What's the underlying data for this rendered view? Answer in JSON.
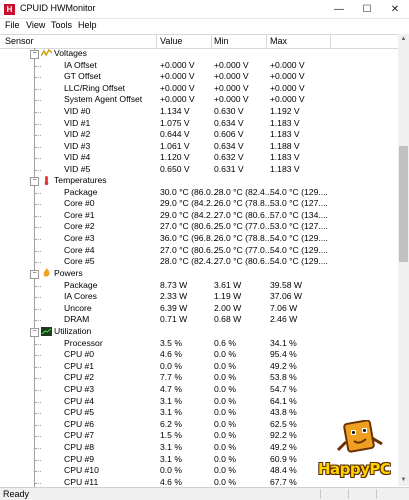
{
  "window": {
    "title": "CPUID HWMonitor",
    "app_icon": "H",
    "status": "Ready",
    "minimize_glyph": "—",
    "maximize_glyph": "☐",
    "close_glyph": "✕"
  },
  "menu": [
    "File",
    "View",
    "Tools",
    "Help"
  ],
  "columns": {
    "sensor": "Sensor",
    "value": "Value",
    "min": "Min",
    "max": "Max"
  },
  "categories": {
    "voltages": "Voltages",
    "temperatures": "Temperatures",
    "powers": "Powers",
    "utilization": "Utilization"
  },
  "rows": [
    {
      "name": "IA Offset",
      "value": "+0.000 V",
      "min": "+0.000 V",
      "max": "+0.000 V"
    },
    {
      "name": "GT Offset",
      "value": "+0.000 V",
      "min": "+0.000 V",
      "max": "+0.000 V"
    },
    {
      "name": "LLC/Ring Offset",
      "value": "+0.000 V",
      "min": "+0.000 V",
      "max": "+0.000 V"
    },
    {
      "name": "System Agent Offset",
      "value": "+0.000 V",
      "min": "+0.000 V",
      "max": "+0.000 V"
    },
    {
      "name": "VID #0",
      "value": "1.134 V",
      "min": "0.630 V",
      "max": "1.192 V"
    },
    {
      "name": "VID #1",
      "value": "1.075 V",
      "min": "0.634 V",
      "max": "1.183 V"
    },
    {
      "name": "VID #2",
      "value": "0.644 V",
      "min": "0.606 V",
      "max": "1.183 V"
    },
    {
      "name": "VID #3",
      "value": "1.061 V",
      "min": "0.634 V",
      "max": "1.188 V"
    },
    {
      "name": "VID #4",
      "value": "1.120 V",
      "min": "0.632 V",
      "max": "1.183 V"
    },
    {
      "name": "VID #5",
      "value": "0.650 V",
      "min": "0.631 V",
      "max": "1.183 V"
    },
    {
      "name": "Package",
      "value": "30.0 °C (86.0...",
      "min": "28.0 °C (82.4...",
      "max": "54.0 °C (129...."
    },
    {
      "name": "Core #0",
      "value": "29.0 °C (84.2...",
      "min": "26.0 °C (78.8...",
      "max": "53.0 °C (127...."
    },
    {
      "name": "Core #1",
      "value": "29.0 °C (84.2...",
      "min": "27.0 °C (80.6...",
      "max": "57.0 °C (134...."
    },
    {
      "name": "Core #2",
      "value": "27.0 °C (80.6...",
      "min": "25.0 °C (77.0...",
      "max": "53.0 °C (127...."
    },
    {
      "name": "Core #3",
      "value": "36.0 °C (96.8...",
      "min": "26.0 °C (78.8...",
      "max": "54.0 °C (129...."
    },
    {
      "name": "Core #4",
      "value": "27.0 °C (80.6...",
      "min": "25.0 °C (77.0...",
      "max": "54.0 °C (129...."
    },
    {
      "name": "Core #5",
      "value": "28.0 °C (82.4...",
      "min": "27.0 °C (80.6...",
      "max": "54.0 °C (129...."
    },
    {
      "name": "Package",
      "value": "8.73 W",
      "min": "3.61 W",
      "max": "39.58 W"
    },
    {
      "name": "IA Cores",
      "value": "2.33 W",
      "min": "1.19 W",
      "max": "37.06 W"
    },
    {
      "name": "Uncore",
      "value": "6.39 W",
      "min": "2.00 W",
      "max": "7.06 W"
    },
    {
      "name": "DRAM",
      "value": "0.71 W",
      "min": "0.68 W",
      "max": "2.46 W"
    },
    {
      "name": "Processor",
      "value": "3.5 %",
      "min": "0.6 %",
      "max": "34.1 %"
    },
    {
      "name": "CPU #0",
      "value": "4.6 %",
      "min": "0.0 %",
      "max": "95.4 %"
    },
    {
      "name": "CPU #1",
      "value": "0.0 %",
      "min": "0.0 %",
      "max": "49.2 %"
    },
    {
      "name": "CPU #2",
      "value": "7.7 %",
      "min": "0.0 %",
      "max": "53.8 %"
    },
    {
      "name": "CPU #3",
      "value": "4.7 %",
      "min": "0.0 %",
      "max": "54.7 %"
    },
    {
      "name": "CPU #4",
      "value": "3.1 %",
      "min": "0.0 %",
      "max": "64.1 %"
    },
    {
      "name": "CPU #5",
      "value": "3.1 %",
      "min": "0.0 %",
      "max": "43.8 %"
    },
    {
      "name": "CPU #6",
      "value": "6.2 %",
      "min": "0.0 %",
      "max": "62.5 %"
    },
    {
      "name": "CPU #7",
      "value": "1.5 %",
      "min": "0.0 %",
      "max": "92.2 %"
    },
    {
      "name": "CPU #8",
      "value": "3.1 %",
      "min": "0.0 %",
      "max": "49.2 %"
    },
    {
      "name": "CPU #9",
      "value": "3.1 %",
      "min": "0.0 %",
      "max": "60.9 %"
    },
    {
      "name": "CPU #10",
      "value": "0.0 %",
      "min": "0.0 %",
      "max": "48.4 %"
    },
    {
      "name": "CPU #11",
      "value": "4.6 %",
      "min": "0.0 %",
      "max": "67.7 %"
    }
  ],
  "watermark": {
    "text": "HappyPC"
  },
  "colors": {
    "app_icon": "#c8102e",
    "watermark_text": "#ffd200"
  }
}
